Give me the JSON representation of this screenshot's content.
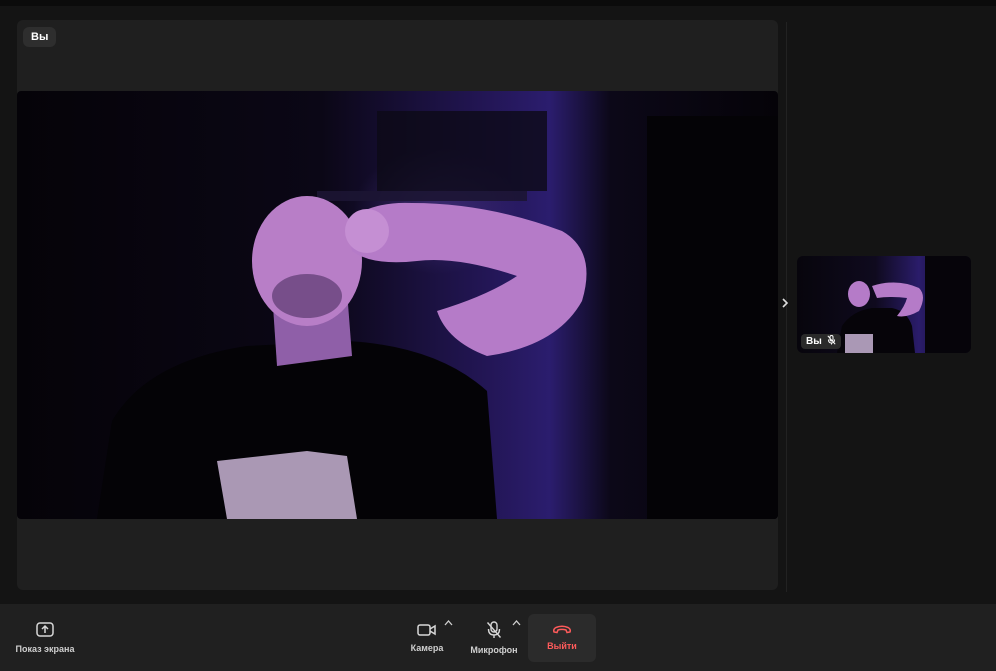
{
  "main_tile": {
    "name_label": "Вы"
  },
  "side_panel": {
    "thumbnail": {
      "name_label": "Вы",
      "mic_icon": "microphone-off-icon"
    },
    "toggle_icon": "chevron-right-icon"
  },
  "toolbar": {
    "share_screen": {
      "label": "Показ экрана",
      "icon": "upload-screen-icon"
    },
    "camera": {
      "label": "Камера",
      "icon": "camera-icon"
    },
    "microphone": {
      "label": "Микрофон",
      "icon": "microphone-off-icon"
    },
    "leave": {
      "label": "Выйти",
      "icon": "phone-hangup-icon",
      "color": "#ff5b5b"
    }
  }
}
